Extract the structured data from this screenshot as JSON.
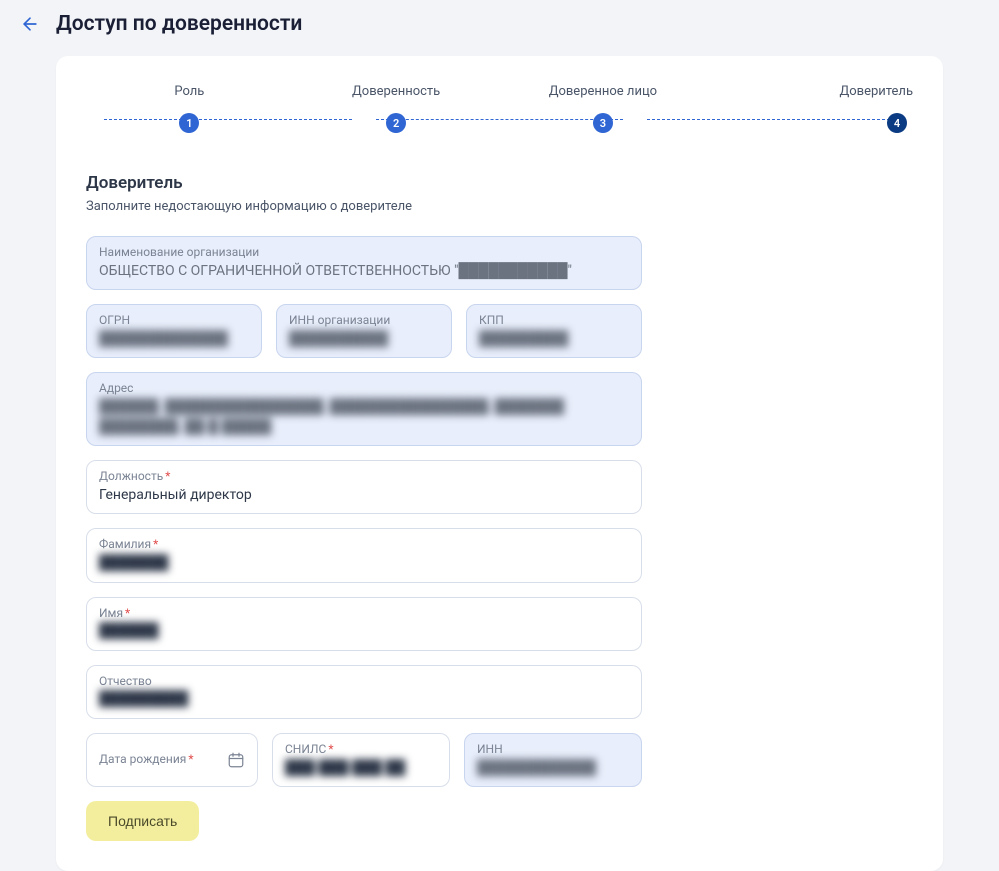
{
  "header": {
    "title": "Доступ по доверенности"
  },
  "stepper": {
    "steps": [
      {
        "label": "Роль",
        "num": "1"
      },
      {
        "label": "Доверенность",
        "num": "2"
      },
      {
        "label": "Доверенное лицо",
        "num": "3"
      },
      {
        "label": "Доверитель",
        "num": "4"
      }
    ]
  },
  "section": {
    "title": "Доверитель",
    "subtitle": "Заполните недостающую информацию о доверителе"
  },
  "fields": {
    "org_name_label": "Наименование организации",
    "org_name_value": "ОБЩЕСТВО С ОГРАНИЧЕННОЙ ОТВЕТСТВЕННОСТЬЮ \"███████████\"",
    "ogrn_label": "ОГРН",
    "ogrn_value": "█████████████",
    "inn_org_label": "ИНН организации",
    "inn_org_value": "██████████",
    "kpp_label": "КПП",
    "kpp_value": "█████████",
    "address_label": "Адрес",
    "address_value": "██████, ████████████████, ████████████████, ███████ ████████, ██-█ █████",
    "position_label": "Должность",
    "position_value": "Генеральный директор",
    "lastname_label": "Фамилия",
    "lastname_value": "███████",
    "firstname_label": "Имя",
    "firstname_value": "██████",
    "patronymic_label": "Отчество",
    "patronymic_value": "█████████",
    "dob_label": "Дата рождения",
    "snils_label": "СНИЛС",
    "snils_value": "███-███-███ ██",
    "inn_label": "ИНН",
    "inn_value": "████████████"
  },
  "buttons": {
    "submit": "Подписать"
  }
}
